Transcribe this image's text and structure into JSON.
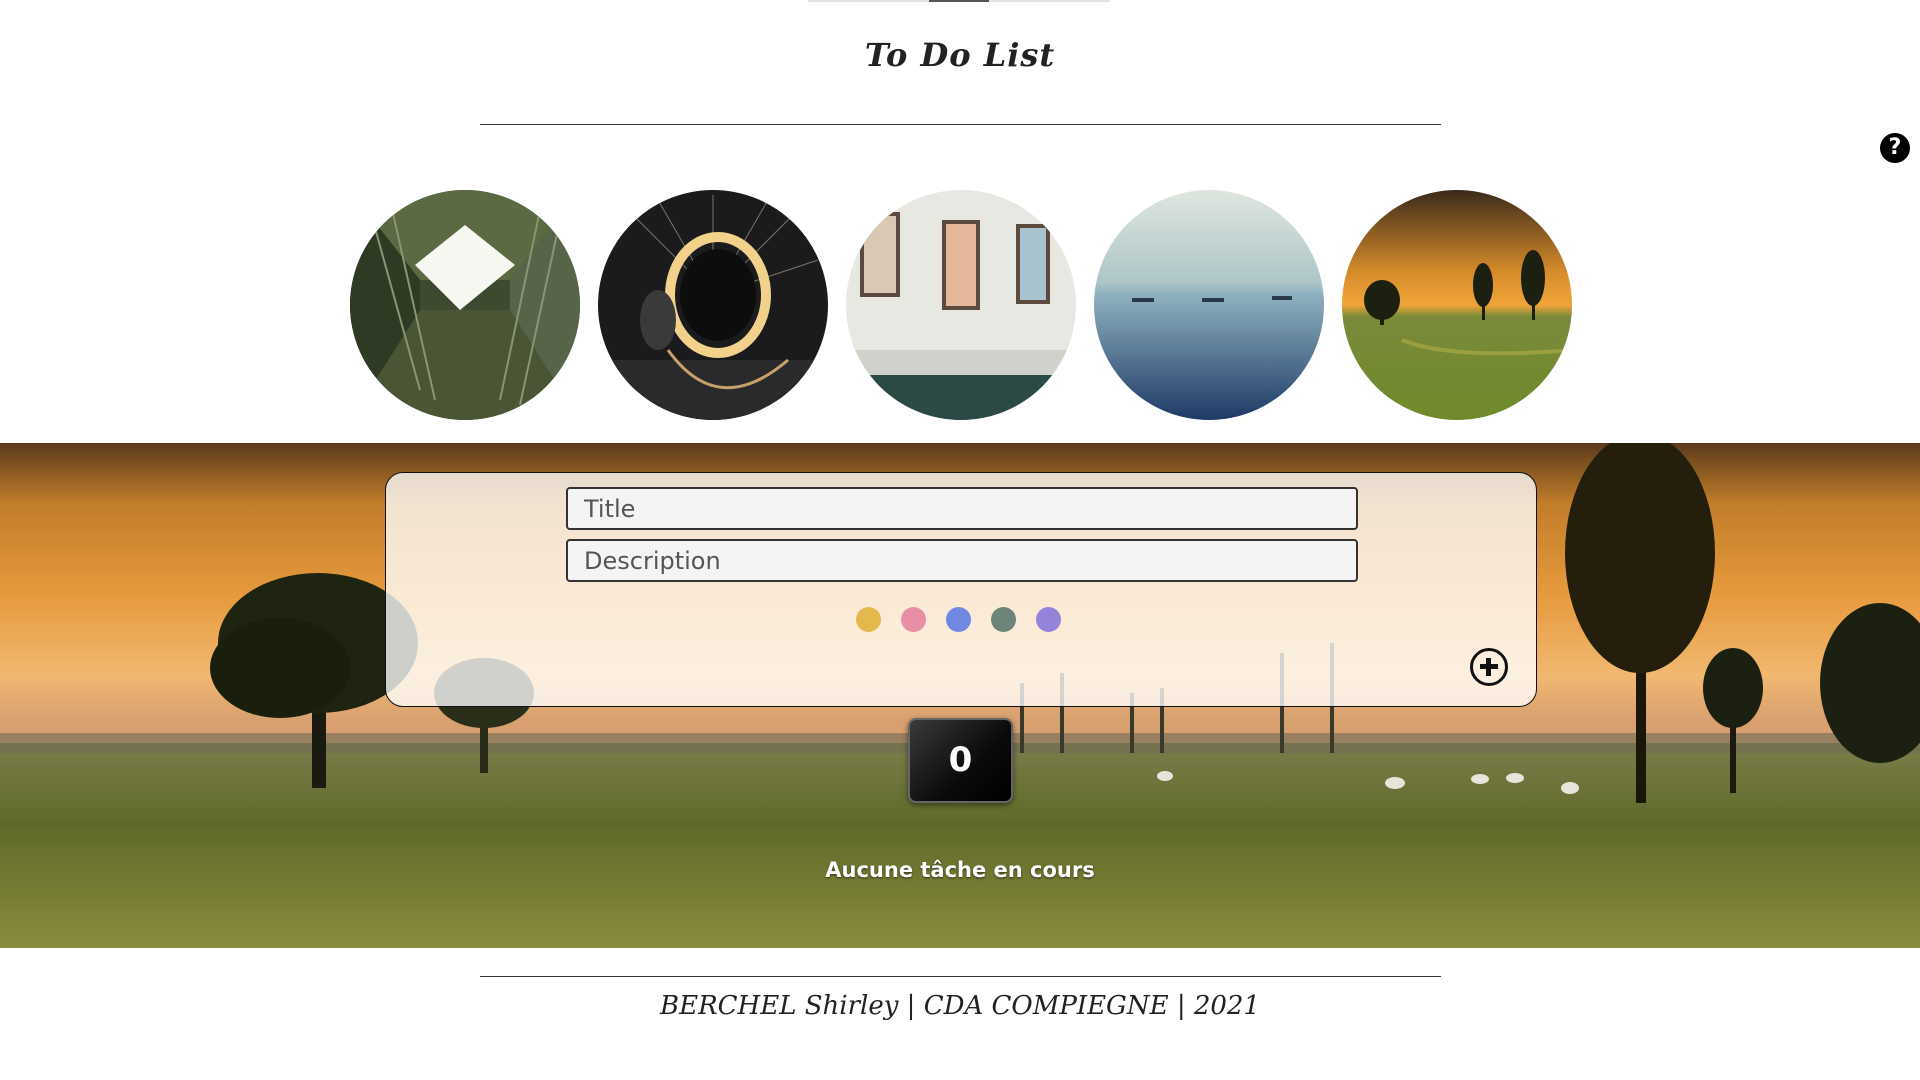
{
  "header": {
    "title": "To Do List",
    "help_icon": "question-circle-icon"
  },
  "themes": [
    {
      "name": "building-courtyard"
    },
    {
      "name": "light-ring"
    },
    {
      "name": "gallery-room"
    },
    {
      "name": "sea-ships"
    },
    {
      "name": "sunset-meadow"
    }
  ],
  "form": {
    "title_placeholder": "Title",
    "description_placeholder": "Description",
    "colors": [
      "#e3b94e",
      "#e88ea5",
      "#7088e1",
      "#6f8478",
      "#9583d9"
    ],
    "add_icon": "plus-circle-icon"
  },
  "counter": {
    "value": "0"
  },
  "status": {
    "text": "Aucune tâche en cours"
  },
  "footer": {
    "text": "BERCHEL Shirley | CDA COMPIEGNE | 2021"
  }
}
